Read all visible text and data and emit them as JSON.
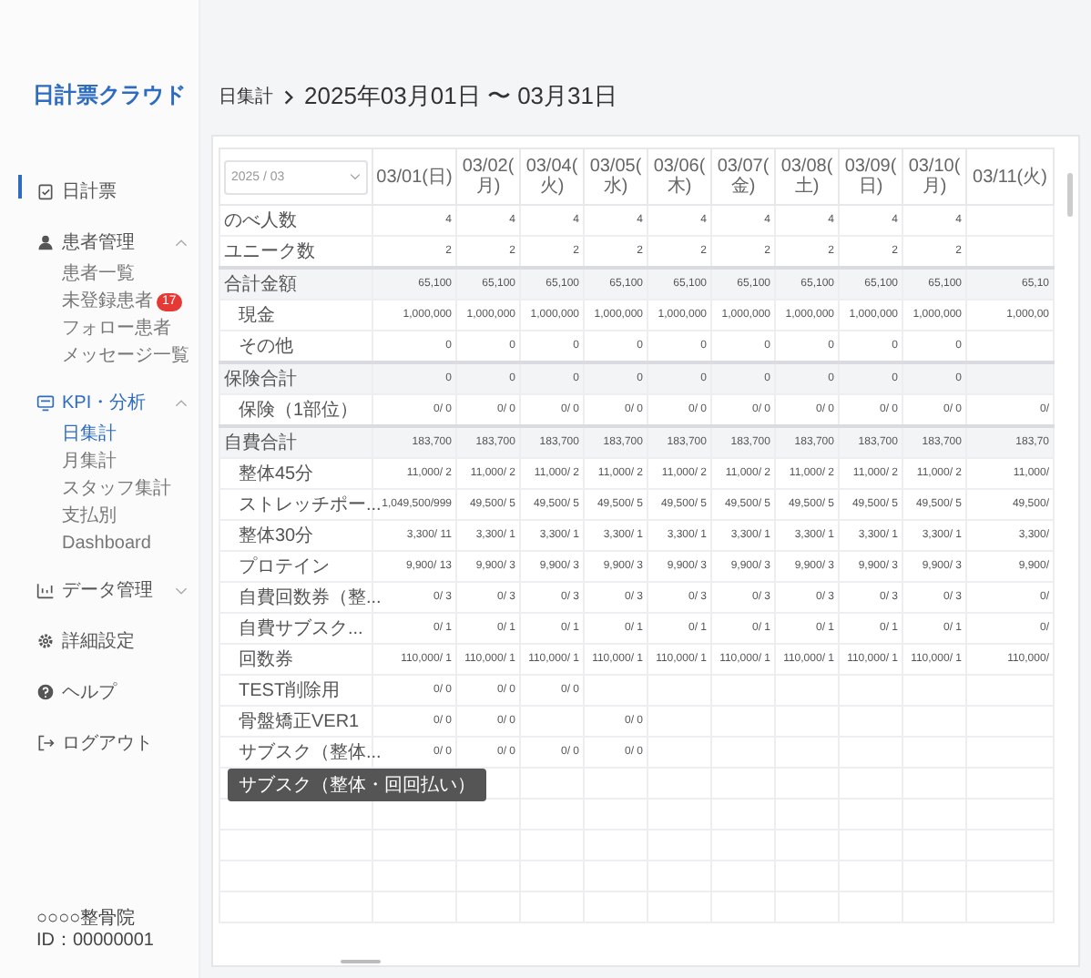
{
  "sidebar": {
    "logo": "日計票クラウド",
    "items": [
      {
        "label": "日計票",
        "selected": true,
        "active": false
      },
      {
        "label": "患者管理",
        "selected": false,
        "active": false,
        "expanded": true,
        "children": [
          {
            "label": "患者一覧",
            "selected": false
          },
          {
            "label": "未登録患者",
            "selected": false,
            "badge": "17"
          },
          {
            "label": "フォロー患者",
            "selected": false
          },
          {
            "label": "メッセージ一覧",
            "selected": false
          }
        ]
      },
      {
        "label": "KPI・分析",
        "selected": false,
        "active": true,
        "expanded": true,
        "children": [
          {
            "label": "日集計",
            "selected": true
          },
          {
            "label": "月集計",
            "selected": false
          },
          {
            "label": "スタッフ集計",
            "selected": false
          },
          {
            "label": "支払別",
            "selected": false
          },
          {
            "label": "Dashboard",
            "selected": false
          }
        ]
      },
      {
        "label": "データ管理",
        "selected": false,
        "active": false,
        "expanded": false
      },
      {
        "label": "詳細設定",
        "selected": false,
        "active": false
      },
      {
        "label": "ヘルプ",
        "selected": false,
        "active": false
      },
      {
        "label": "ログアウト",
        "selected": false,
        "active": false
      }
    ],
    "clinic": "○○○○整骨院",
    "account_id": "ID：00000001"
  },
  "breadcrumb": {
    "parent": "日集計",
    "current": "2025年03月01日 〜 03月31日"
  },
  "table": {
    "month_select": {
      "value": "2025 / 03"
    },
    "columns": [
      "03/01(日)",
      "03/02(月)",
      "03/04(火)",
      "03/05(水)",
      "03/06(木)",
      "03/07(金)",
      "03/08(土)",
      "03/09(日)",
      "03/10(月)",
      "03/11(火)"
    ],
    "rows": [
      {
        "label": "のべ人数",
        "kind": "item",
        "cells": [
          "4",
          "4",
          "4",
          "4",
          "4",
          "4",
          "4",
          "4",
          "4",
          null
        ]
      },
      {
        "label": "ユニーク数",
        "kind": "item",
        "cells": [
          "2",
          "2",
          "2",
          "2",
          "2",
          "2",
          "2",
          "2",
          "2",
          null
        ]
      },
      {
        "label": "合計金額",
        "kind": "total",
        "cells": [
          "65,100",
          "65,100",
          "65,100",
          "65,100",
          "65,100",
          "65,100",
          "65,100",
          "65,100",
          "65,100",
          "65,10"
        ]
      },
      {
        "label": "現金",
        "kind": "sub",
        "cells": [
          "1,000,000",
          "1,000,000",
          "1,000,000",
          "1,000,000",
          "1,000,000",
          "1,000,000",
          "1,000,000",
          "1,000,000",
          "1,000,000",
          "1,000,00"
        ]
      },
      {
        "label": "その他",
        "kind": "sub",
        "cells": [
          "0",
          "0",
          "0",
          "0",
          "0",
          "0",
          "0",
          "0",
          "0",
          null
        ]
      },
      {
        "label": "保険合計",
        "kind": "total",
        "cells": [
          "0",
          "0",
          "0",
          "0",
          "0",
          "0",
          "0",
          "0",
          "0",
          null
        ]
      },
      {
        "label": "保険（1部位）",
        "kind": "sub",
        "cells": [
          "0/ 0",
          "0/ 0",
          "0/ 0",
          "0/ 0",
          "0/ 0",
          "0/ 0",
          "0/ 0",
          "0/ 0",
          "0/ 0",
          "0/"
        ]
      },
      {
        "label": "自費合計",
        "kind": "total",
        "cells": [
          "183,700",
          "183,700",
          "183,700",
          "183,700",
          "183,700",
          "183,700",
          "183,700",
          "183,700",
          "183,700",
          "183,70"
        ]
      },
      {
        "label": "整体45分",
        "kind": "sub",
        "cells": [
          "11,000/ 2",
          "11,000/ 2",
          "11,000/ 2",
          "11,000/ 2",
          "11,000/ 2",
          "11,000/ 2",
          "11,000/ 2",
          "11,000/ 2",
          "11,000/ 2",
          "11,000/"
        ]
      },
      {
        "label": "ストレッチポー...",
        "kind": "sub",
        "cells": [
          "1,049,500/999",
          "49,500/ 5",
          "49,500/ 5",
          "49,500/ 5",
          "49,500/ 5",
          "49,500/ 5",
          "49,500/ 5",
          "49,500/ 5",
          "49,500/ 5",
          "49,500/"
        ]
      },
      {
        "label": "整体30分",
        "kind": "sub",
        "cells": [
          "3,300/ 11",
          "3,300/ 1",
          "3,300/ 1",
          "3,300/ 1",
          "3,300/ 1",
          "3,300/ 1",
          "3,300/ 1",
          "3,300/ 1",
          "3,300/ 1",
          "3,300/"
        ]
      },
      {
        "label": "プロテイン",
        "kind": "sub",
        "cells": [
          "9,900/ 13",
          "9,900/ 3",
          "9,900/ 3",
          "9,900/ 3",
          "9,900/ 3",
          "9,900/ 3",
          "9,900/ 3",
          "9,900/ 3",
          "9,900/ 3",
          "9,900/"
        ]
      },
      {
        "label": "自費回数券（整...",
        "kind": "sub",
        "cells": [
          "0/ 3",
          "0/ 3",
          "0/ 3",
          "0/ 3",
          "0/ 3",
          "0/ 3",
          "0/ 3",
          "0/ 3",
          "0/ 3",
          "0/"
        ]
      },
      {
        "label": "自費サブスク...",
        "kind": "sub",
        "cells": [
          "0/ 1",
          "0/ 1",
          "0/ 1",
          "0/ 1",
          "0/ 1",
          "0/ 1",
          "0/ 1",
          "0/ 1",
          "0/ 1",
          "0/"
        ]
      },
      {
        "label": "回数券",
        "kind": "sub",
        "cells": [
          "110,000/ 1",
          "110,000/ 1",
          "110,000/ 1",
          "110,000/ 1",
          "110,000/ 1",
          "110,000/ 1",
          "110,000/ 1",
          "110,000/ 1",
          "110,000/ 1",
          "110,000/"
        ]
      },
      {
        "label": "TEST削除用",
        "kind": "sub",
        "cells": [
          "0/ 0",
          "0/ 0",
          "0/ 0",
          null,
          null,
          null,
          null,
          null,
          null,
          null
        ]
      },
      {
        "label": "骨盤矯正VER1",
        "kind": "sub",
        "cells": [
          "0/ 0",
          "0/ 0",
          null,
          "0/ 0",
          null,
          null,
          null,
          null,
          null,
          null
        ]
      },
      {
        "label": "サブスク（整体...",
        "kind": "sub",
        "cells": [
          "0/ 0",
          "0/ 0",
          "0/ 0",
          "0/ 0",
          null,
          null,
          null,
          null,
          null,
          null
        ]
      }
    ],
    "tooltip": "サブスク（整体・回回払い）"
  }
}
